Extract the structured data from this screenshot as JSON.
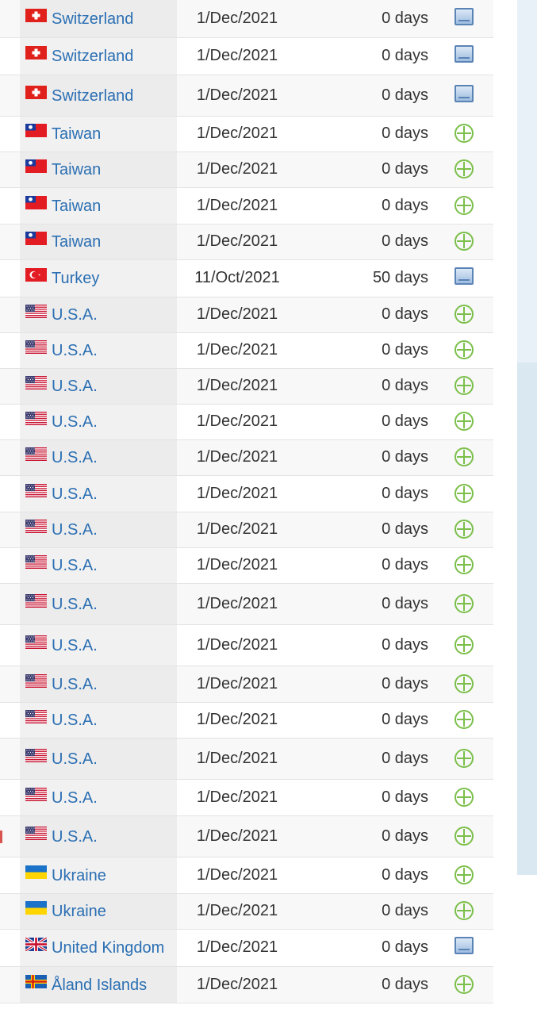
{
  "rows": [
    {
      "country": "Switzerland",
      "flag": "ch",
      "date": "1/Dec/2021",
      "days": "0 days",
      "icon": "monitor-icon"
    },
    {
      "country": "Switzerland",
      "flag": "ch",
      "date": "1/Dec/2021",
      "days": "0 days",
      "icon": "monitor-icon"
    },
    {
      "country": "Switzerland",
      "flag": "ch",
      "date": "1/Dec/2021",
      "days": "0 days",
      "icon": "monitor-icon"
    },
    {
      "country": "Taiwan",
      "flag": "tw",
      "date": "1/Dec/2021",
      "days": "0 days",
      "icon": "circle-plus-icon"
    },
    {
      "country": "Taiwan",
      "flag": "tw",
      "date": "1/Dec/2021",
      "days": "0 days",
      "icon": "circle-plus-icon"
    },
    {
      "country": "Taiwan",
      "flag": "tw",
      "date": "1/Dec/2021",
      "days": "0 days",
      "icon": "circle-plus-icon"
    },
    {
      "country": "Taiwan",
      "flag": "tw",
      "date": "1/Dec/2021",
      "days": "0 days",
      "icon": "circle-plus-icon"
    },
    {
      "country": "Turkey",
      "flag": "tr",
      "date": "11/Oct/2021",
      "days": "50 days",
      "icon": "monitor-icon"
    },
    {
      "country": "U.S.A.",
      "flag": "us",
      "date": "1/Dec/2021",
      "days": "0 days",
      "icon": "circle-plus-icon"
    },
    {
      "country": "U.S.A.",
      "flag": "us",
      "date": "1/Dec/2021",
      "days": "0 days",
      "icon": "circle-plus-icon"
    },
    {
      "country": "U.S.A.",
      "flag": "us",
      "date": "1/Dec/2021",
      "days": "0 days",
      "icon": "circle-plus-icon"
    },
    {
      "country": "U.S.A.",
      "flag": "us",
      "date": "1/Dec/2021",
      "days": "0 days",
      "icon": "circle-plus-icon"
    },
    {
      "country": "U.S.A.",
      "flag": "us",
      "date": "1/Dec/2021",
      "days": "0 days",
      "icon": "circle-plus-icon"
    },
    {
      "country": "U.S.A.",
      "flag": "us",
      "date": "1/Dec/2021",
      "days": "0 days",
      "icon": "circle-plus-icon"
    },
    {
      "country": "U.S.A.",
      "flag": "us",
      "date": "1/Dec/2021",
      "days": "0 days",
      "icon": "circle-plus-icon"
    },
    {
      "country": "U.S.A.",
      "flag": "us",
      "date": "1/Dec/2021",
      "days": "0 days",
      "icon": "circle-plus-icon"
    },
    {
      "country": "U.S.A.",
      "flag": "us",
      "date": "1/Dec/2021",
      "days": "0 days",
      "icon": "circle-plus-icon"
    },
    {
      "country": "U.S.A.",
      "flag": "us",
      "date": "1/Dec/2021",
      "days": "0 days",
      "icon": "circle-plus-icon"
    },
    {
      "country": "U.S.A.",
      "flag": "us",
      "date": "1/Dec/2021",
      "days": "0 days",
      "icon": "circle-plus-icon"
    },
    {
      "country": "U.S.A.",
      "flag": "us",
      "date": "1/Dec/2021",
      "days": "0 days",
      "icon": "circle-plus-icon"
    },
    {
      "country": "U.S.A.",
      "flag": "us",
      "date": "1/Dec/2021",
      "days": "0 days",
      "icon": "circle-plus-icon"
    },
    {
      "country": "U.S.A.",
      "flag": "us",
      "date": "1/Dec/2021",
      "days": "0 days",
      "icon": "circle-plus-icon"
    },
    {
      "country": "U.S.A.",
      "flag": "us",
      "date": "1/Dec/2021",
      "days": "0 days",
      "icon": "circle-plus-icon"
    },
    {
      "country": "Ukraine",
      "flag": "ua",
      "date": "1/Dec/2021",
      "days": "0 days",
      "icon": "circle-plus-icon"
    },
    {
      "country": "Ukraine",
      "flag": "ua",
      "date": "1/Dec/2021",
      "days": "0 days",
      "icon": "circle-plus-icon"
    },
    {
      "country": "United Kingdom",
      "flag": "gb",
      "date": "1/Dec/2021",
      "days": "0 days",
      "icon": "monitor-icon"
    },
    {
      "country": "Åland Islands",
      "flag": "ax",
      "date": "1/Dec/2021",
      "days": "0 days",
      "icon": "circle-plus-icon"
    }
  ],
  "colors": {
    "link": "#2b6fb3",
    "text": "#333333",
    "plus_icon": "#7bbf4a",
    "monitor_icon": "#5b84b6"
  }
}
